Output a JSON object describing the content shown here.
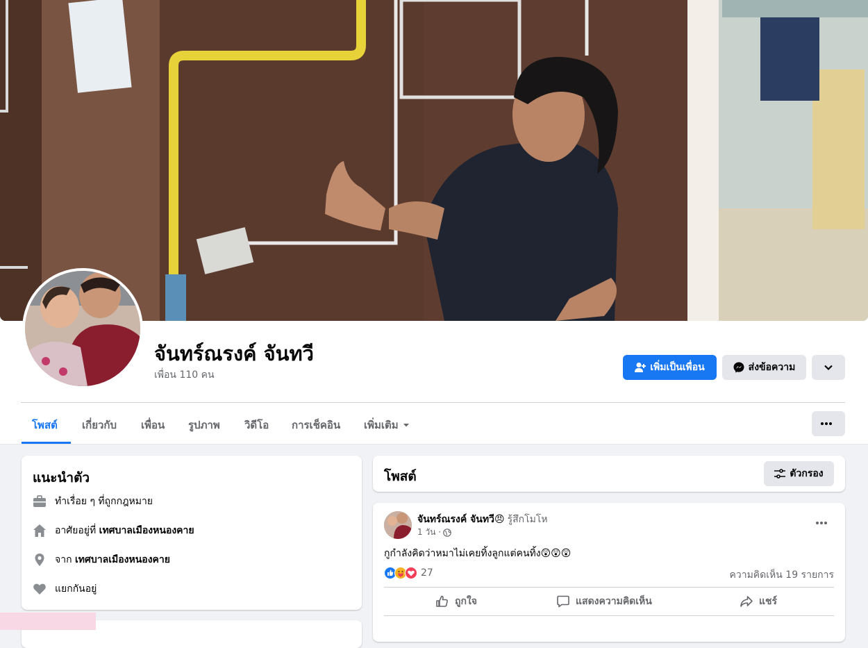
{
  "profile": {
    "name": "จันทร์ณรงค์ จันทวี",
    "friends": "เพื่อน 110 คน"
  },
  "actions": {
    "add_friend": "เพิ่มเป็นเพื่อน",
    "message": "ส่งข้อความ"
  },
  "tabs": [
    {
      "label": "โพสต์",
      "active": true
    },
    {
      "label": "เกี่ยวกับ"
    },
    {
      "label": "เพื่อน"
    },
    {
      "label": "รูปภาพ"
    },
    {
      "label": "วิดีโอ"
    },
    {
      "label": "การเช็คอิน"
    },
    {
      "label": "เพิ่มเติม"
    }
  ],
  "intro": {
    "title": "แนะนำตัว",
    "work": "ทำเรื่อย ๆ ที่ถูกกฎหมาย",
    "lives_prefix": "อาศัยอยู่ที่",
    "lives_place": "เทศบาลเมืองหนองคาย",
    "from_prefix": "จาก",
    "from_place": "เทศบาลเมืองหนองคาย",
    "relationship": "แยกกันอยู่"
  },
  "posts_header": {
    "title": "โพสต์",
    "filter": "ตัวกรอง"
  },
  "post": {
    "author": "จันทร์ณรงค์ จันทวี",
    "feeling_emoji": "😠",
    "feeling": "รู้สึกโมโห",
    "time": "1 วัน ·",
    "text": "กูกำลังคิดว่าหมาไม่เคยทิ้งลูกแต่คนทิ้ง😲😲😲",
    "reaction_count": "27",
    "comments": "ความคิดเห็น 19 รายการ",
    "like": "ถูกใจ",
    "comment": "แสดงความคิดเห็น",
    "share": "แชร์"
  },
  "colors": {
    "accent": "#1877f2",
    "background": "#f0f2f5",
    "secondary_button": "#e4e6eb"
  }
}
